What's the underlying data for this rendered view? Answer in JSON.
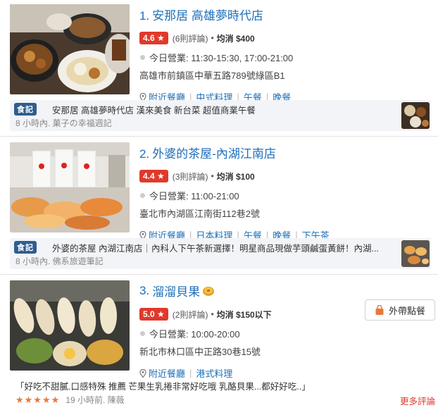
{
  "restaurants": [
    {
      "number": "1.",
      "name": "安那居 高雄夢時代店",
      "rating": "4.6 ★",
      "reviews": "(6則評論)",
      "price_label": "均消 $400",
      "hours": "今日營業: 11:30-15:30, 17:00-21:00",
      "address": "高雄市前鎮區中華五路789號綠區B1",
      "tags": [
        "附近餐廳",
        "中式料理",
        "午餐",
        "晚餐"
      ],
      "note_label": "食記",
      "note_text": "安那居 高雄夢時代店 漢來美食 新台菜 超值商業午餐",
      "note_source": "8 小時內. 菓子の幸福週記"
    },
    {
      "number": "2.",
      "name": "外婆的茶屋-內湖江南店",
      "rating": "4.4 ★",
      "reviews": "(3則評論)",
      "price_label": "均消 $100",
      "hours": "今日營業: 11:00-21:00",
      "address": "臺北市內湖區江南街112巷2號",
      "tags": [
        "附近餐廳",
        "日本料理",
        "午餐",
        "晚餐",
        "下午茶"
      ],
      "note_label": "食記",
      "note_text": "外婆的茶屋 內湖江南店｜內科人下午茶新選擇！明星商品現做芋頭鹹蛋黃餅！內湖...",
      "note_source": "8 小時內. 佛系旅遊筆記"
    },
    {
      "number": "3.",
      "name": "溜溜貝果",
      "rating": "5.0 ★",
      "reviews": "(2則評論)",
      "price_label": "均消 $150以下",
      "hours": "今日營業: 10:00-20:00",
      "address": "新北市林口區中正路30巷15號",
      "tags": [
        "附近餐廳",
        "港式料理"
      ],
      "takeout_label": "外帶點餐",
      "review_text": "「好吃不甜膩.口感特殊 推薦 芒果生乳捲非常好吃哦 乳酪貝果...都好好吃..」",
      "review_stars": "★★★★★",
      "review_meta": "19 小時前. 陳薇",
      "more_reviews": "更多評論"
    }
  ],
  "colors": {
    "link": "#1e6fb8",
    "badge": "#e0392b",
    "note_label": "#2f5d8e",
    "stars": "#e8783a"
  }
}
